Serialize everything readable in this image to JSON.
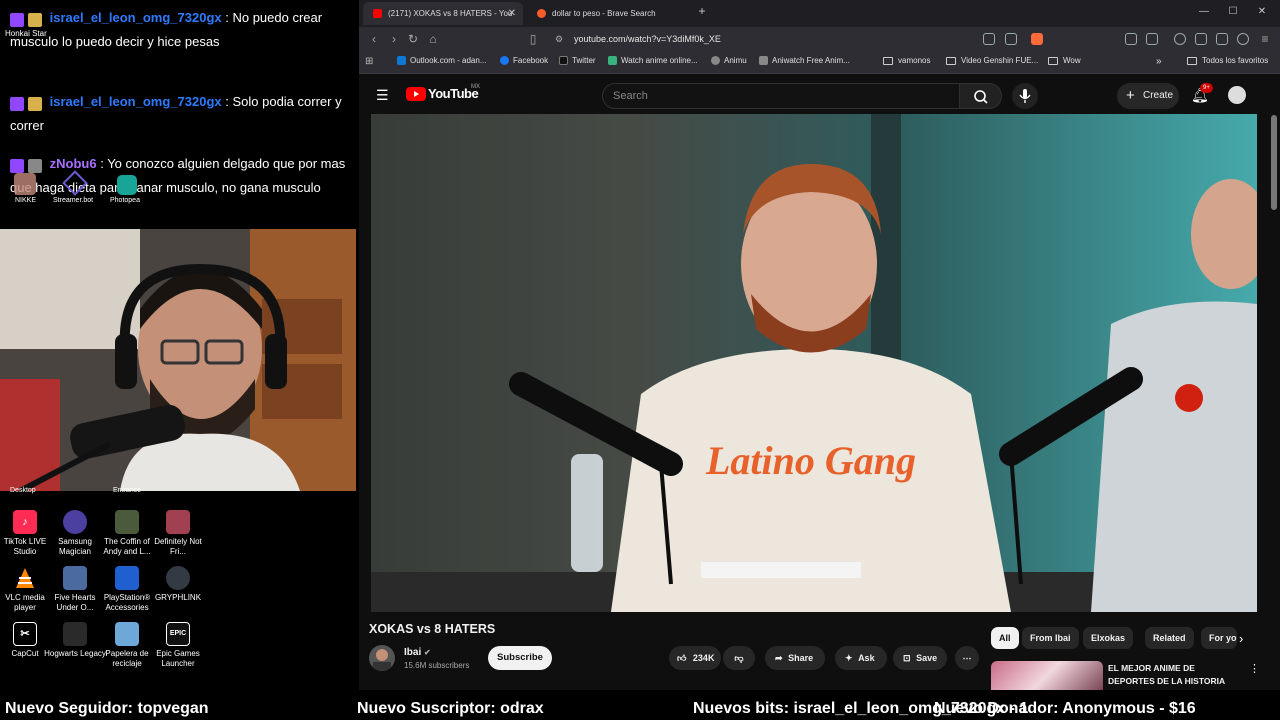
{
  "chat": [
    {
      "user": "israel_el_leon_omg_7320gx",
      "user_color": "#2e7bff",
      "text": ": No puedo crear musculo lo puedo decir y hice pesas",
      "badge_icons": [
        "twitch-badge",
        "crown-badge"
      ]
    },
    {
      "user": "israel_el_leon_omg_7320gx",
      "user_color": "#2e7bff",
      "text": ": Solo podia correr y correr",
      "badge_icons": [
        "twitch-badge",
        "crown-badge"
      ]
    },
    {
      "user": "zNobu6",
      "user_color": "#a970ff",
      "text": ": Yo conozco alguien delgado que por mas que haga dieta para ganar musculo, no gana musculo",
      "badge_icons": [
        "twitch-badge",
        "sub-badge"
      ]
    }
  ],
  "desktop": {
    "overlay_labels": [
      "Honkai Star",
      "NIKKE",
      "Streamer.bot",
      "Photopea",
      "Desktop",
      "Entrance"
    ],
    "icons": [
      {
        "label": "TikTok LIVE Studio",
        "icon": "tiktok-icon",
        "color": "#fe2c55"
      },
      {
        "label": "Samsung Magician",
        "icon": "samsung-magician-icon",
        "color": "#4b3fa0"
      },
      {
        "label": "The Coffin of Andy and L...",
        "icon": "game-icon",
        "color": "#4a5a3a"
      },
      {
        "label": "Definitely Not Fri...",
        "icon": "game-icon",
        "color": "#a04050"
      },
      {
        "label": "VLC media player",
        "icon": "vlc-icon",
        "color": "#ff8800"
      },
      {
        "label": "Five Hearts Under O...",
        "icon": "game-icon",
        "color": "#4a6aa0"
      },
      {
        "label": "PlayStation® Accessories",
        "icon": "playstation-icon",
        "color": "#1f5fcf"
      },
      {
        "label": "GRYPHLINK",
        "icon": "gryphlink-icon",
        "color": "#333a44"
      },
      {
        "label": "CapCut",
        "icon": "capcut-icon",
        "color": "#000000"
      },
      {
        "label": "Hogwarts Legacy",
        "icon": "hogwarts-icon",
        "color": "#2a2a2a"
      },
      {
        "label": "Papelera de reciclaje",
        "icon": "recycle-bin-icon",
        "color": "#6ea8d8"
      },
      {
        "label": "Epic Games Launcher",
        "icon": "epic-games-icon",
        "color": "#111111"
      }
    ]
  },
  "browser": {
    "tabs": [
      {
        "title": "(2171) XOKAS vs 8 HATERS - You",
        "icon": "youtube-icon",
        "active": true
      },
      {
        "title": "dollar to peso - Brave Search",
        "icon": "brave-search-icon",
        "active": false
      }
    ],
    "url": "youtube.com/watch?v=Y3diMf0k_XE",
    "bookmarks": [
      {
        "label": "Outlook.com - adan...",
        "icon": "outlook-icon",
        "color": "#0f78d4"
      },
      {
        "label": "Facebook",
        "icon": "facebook-icon",
        "color": "#1877f2"
      },
      {
        "label": "Twitter",
        "icon": "twitter-icon",
        "color": "#111111"
      },
      {
        "label": "Watch anime online...",
        "icon": "anime-icon",
        "color": "#36b37e"
      },
      {
        "label": "Animu",
        "icon": "globe-icon",
        "color": "#888888"
      },
      {
        "label": "Aniwatch Free Anim...",
        "icon": "aniwatch-icon",
        "color": "#888888"
      },
      {
        "label": "vamonos",
        "icon": "folder-icon",
        "color": ""
      },
      {
        "label": "Video Genshin FUE...",
        "icon": "folder-icon",
        "color": ""
      },
      {
        "label": "Wow",
        "icon": "folder-icon",
        "color": ""
      }
    ],
    "all_bookmarks": "Todos los favoritos"
  },
  "youtube": {
    "logo": "YouTube",
    "region": "MX",
    "search_placeholder": "Search",
    "create_label": "Create",
    "notif_count": "9+",
    "video_title": "XOKAS vs 8 HATERS",
    "channel": "Ibai",
    "subscribers": "15.6M subscribers",
    "subscribe_label": "Subscribe",
    "likes": "234K",
    "share_label": "Share",
    "ask_label": "Ask",
    "save_label": "Save",
    "chips": [
      "All",
      "From Ibai",
      "Elxokas",
      "Related",
      "For yo"
    ],
    "recommended_title": "EL MEJOR ANIME DE DEPORTES DE LA HISTORIA"
  },
  "ticker": {
    "follower": "Nuevo Seguidor: topvegan",
    "subscriber": "Nuevo Suscriptor: odrax",
    "bits": "Nuevos bits: israel_el_leon_omg_7320gx - 1",
    "donor": "Nuevo Donador: Anonymous - $16"
  },
  "colors": {
    "youtube_red": "#ff0000",
    "twitch_purple": "#9146ff",
    "notif_red": "#cc0000"
  }
}
